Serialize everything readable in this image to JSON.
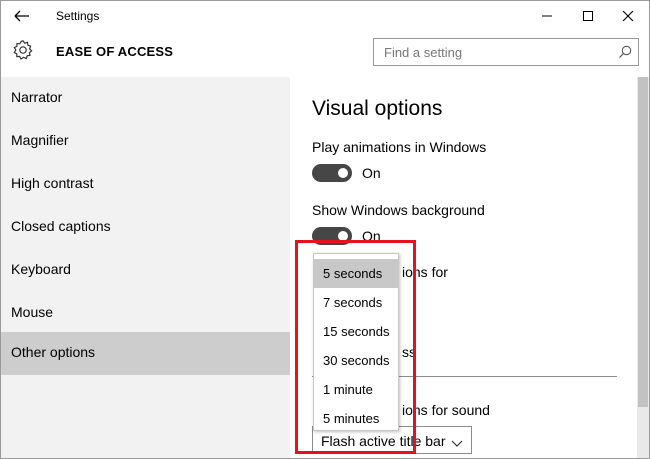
{
  "titlebar": {
    "title": "Settings",
    "back_icon": "arrow-left-icon",
    "minimize_icon": "minimize-icon",
    "maximize_icon": "maximize-icon",
    "close_icon": "close-icon"
  },
  "header": {
    "icon": "gear-icon",
    "title": "EASE OF ACCESS",
    "search": {
      "placeholder": "Find a setting",
      "value": "",
      "icon": "search-icon"
    }
  },
  "sidebar": {
    "items": [
      {
        "label": "Narrator"
      },
      {
        "label": "Magnifier"
      },
      {
        "label": "High contrast"
      },
      {
        "label": "Closed captions"
      },
      {
        "label": "Keyboard"
      },
      {
        "label": "Mouse"
      },
      {
        "label": "Other options",
        "selected": true
      }
    ]
  },
  "main": {
    "title": "Visual options",
    "animations": {
      "label": "Play animations in Windows",
      "state": "On",
      "on": true
    },
    "background": {
      "label": "Show Windows background",
      "state": "On",
      "on": true
    },
    "notifications_label_visible": "ions for",
    "section2_visible": "ss",
    "sound_label_visible": "ions for sound",
    "sound_select_value": "Flash active title bar",
    "chevron_icon": "chevron-down-icon"
  },
  "dropdown": {
    "options": [
      "5 seconds",
      "7 seconds",
      "15 seconds",
      "30 seconds",
      "1 minute",
      "5 minutes"
    ],
    "selected": "5 seconds"
  },
  "colors": {
    "accent_highlight": "#e8101a",
    "toggle_on": "#464646",
    "sidebar_bg": "#f2f2f2",
    "sidebar_selected": "#cdcdcd",
    "dropdown_selected": "#c8c8c8"
  }
}
